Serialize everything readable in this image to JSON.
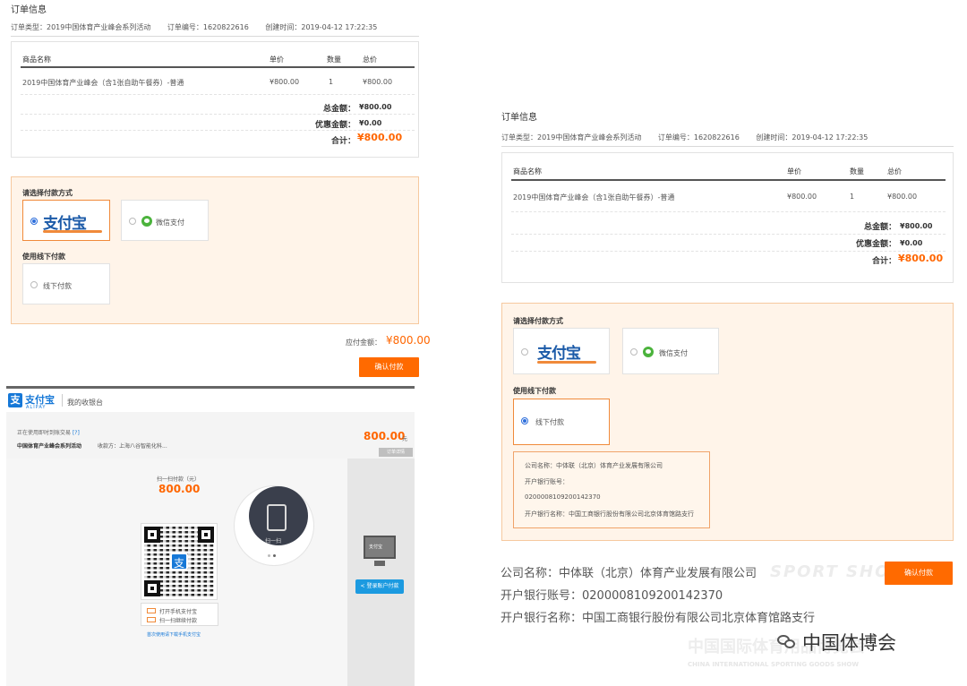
{
  "left_order": {
    "title": "订单信息",
    "meta": [
      "订单类型：2019中国体育产业峰会系列活动",
      "订单编号：1620822616",
      "创建时间：2019-04-12 17:22:35"
    ],
    "headers": [
      "商品名称",
      "单价",
      "数量",
      "总价"
    ],
    "row": [
      "2019中国体育产业峰会（含1张自助午餐券）-普通",
      "¥800.00",
      "1",
      "¥800.00"
    ],
    "total_label": "总金额：",
    "total_value": "¥800.00",
    "discount_label": "优惠金额：",
    "discount_value": "¥0.00",
    "sum_label": "合计：",
    "sum_value": "¥800.00"
  },
  "left_pay": {
    "choose_label": "请选择付款方式",
    "alipay_logo": "支付宝",
    "wechat_label": "微信支付",
    "offline_head": "使用线下付款",
    "offline_label": "线下付款",
    "payable_label": "应付金额：",
    "payable_value": "¥800.00",
    "confirm_label": "确认付款"
  },
  "cashier": {
    "brand": "支付宝",
    "brand_sub": "ALIPAY",
    "brand_tab": "我的收银台",
    "notice": "正在使用即时到账交易",
    "notice_link": "[?]",
    "merchant": "中国体育产业峰会系列活动",
    "payee": "收款方：上海八谷智能化科...",
    "amount": "800.00",
    "amount_unit": "元",
    "detail_tab": "订单详情",
    "scan_title": "扫一扫付款（元）",
    "scan_amount": "800.00",
    "scan_hint1": "打开手机支付宝",
    "scan_hint2": "扫一扫继续付款",
    "scan_icon_label": "扫一扫",
    "download_link": "首次使用请下载手机支付宝",
    "pc_pay_label": "登录账户付款",
    "pc_logo": "支付宝"
  },
  "right_order": {
    "title": "订单信息",
    "meta": [
      "订单类型：2019中国体育产业峰会系列活动",
      "订单编号：1620822616",
      "创建时间：2019-04-12 17:22:35"
    ],
    "headers": [
      "商品名称",
      "单价",
      "数量",
      "总价"
    ],
    "row": [
      "2019中国体育产业峰会（含1张自助午餐券）-普通",
      "¥800.00",
      "1",
      "¥800.00"
    ],
    "total_label": "总金额：",
    "total_value": "¥800.00",
    "discount_label": "优惠金额：",
    "discount_value": "¥0.00",
    "sum_label": "合计：",
    "sum_value": "¥800.00"
  },
  "right_pay": {
    "choose_label": "请选择付款方式",
    "alipay_logo": "支付宝",
    "wechat_label": "微信支付",
    "offline_head": "使用线下付款",
    "offline_label": "线下付款",
    "bank_lines": [
      "公司名称：中体联（北京）体育产业发展有限公司",
      "开户银行账号：",
      "0200008109200142370",
      "开户银行名称：中国工商银行股份有限公司北京体育馆路支行"
    ],
    "confirm_label": "确认付款"
  },
  "bank_info": {
    "company": "公司名称：中体联（北京）体育产业发展有限公司",
    "account": "开户银行账号：0200008109200142370",
    "bank": "开户银行名称：中国工商银行股份有限公司北京体育馆路支行"
  },
  "watermark": {
    "brand": "中国体博会",
    "cn": "中国国际体育用品博览会",
    "en": "CHINA INTERNATIONAL SPORTING GOODS SHOW",
    "sport": "SPORT SHOW"
  },
  "colors": {
    "accent": "#ff6a00",
    "alipay_blue": "#1678d7",
    "wechat_green": "#4bb33c",
    "panel_bg": "#fff4e9"
  }
}
